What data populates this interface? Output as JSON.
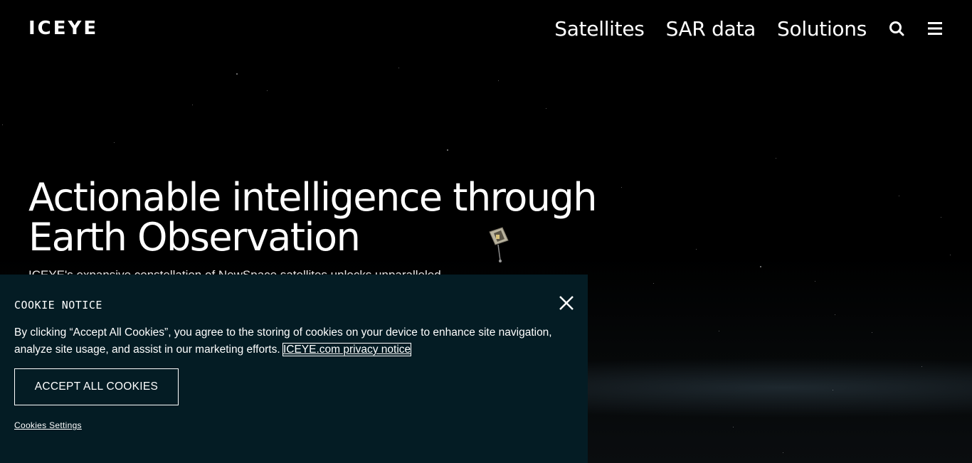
{
  "header": {
    "logo": "ICEYE",
    "nav": [
      {
        "label": "Satellites"
      },
      {
        "label": "SAR data"
      },
      {
        "label": "Solutions"
      }
    ],
    "search_icon": "search-icon",
    "menu_icon": "hamburger-menu-icon"
  },
  "hero": {
    "title_line1": "Actionable intelligence through",
    "title_line2": "Earth Observation",
    "subtitle": "ICEYE's expansive constellation of NewSpace satellites unlocks unparalleled"
  },
  "cookie": {
    "title": "COOKIE NOTICE",
    "close_icon": "close-icon",
    "text": "By clicking “Accept All Cookies”, you agree to the storing of cookies on your device to enhance site navigation, analyze site usage, and assist in our marketing efforts.",
    "privacy_link": "ICEYE.com privacy notice",
    "accept_label": "ACCEPT ALL COOKIES",
    "settings_label": "Cookies Settings"
  },
  "colors": {
    "background": "#000000",
    "cookie_panel": "#041c24",
    "text": "#ffffff"
  }
}
